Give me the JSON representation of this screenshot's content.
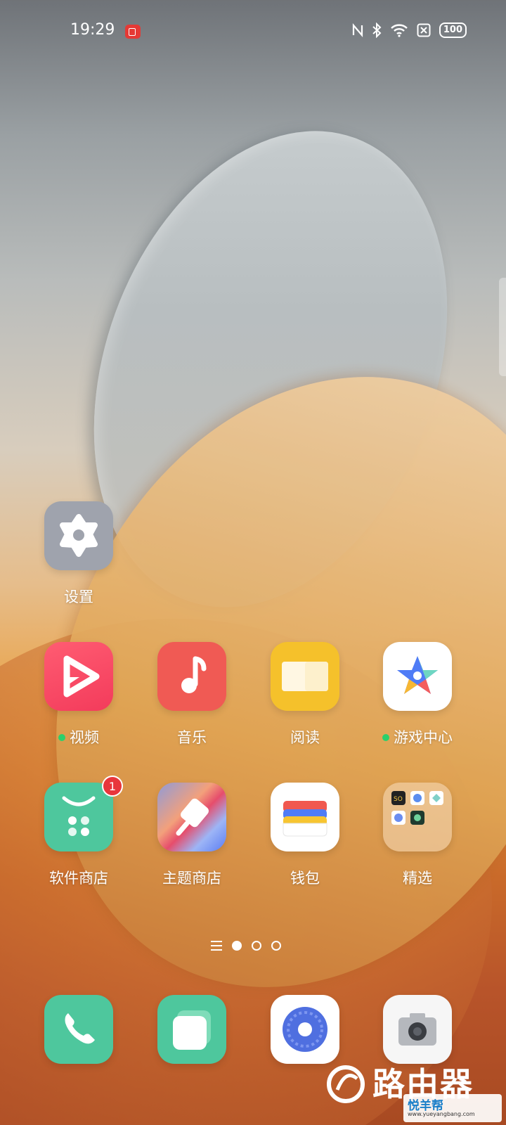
{
  "status_bar": {
    "time": "19:29",
    "icons": [
      "screen-record-icon",
      "nfc-icon",
      "bluetooth-icon",
      "wifi-icon",
      "sim-icon",
      "battery-icon"
    ],
    "battery": "100"
  },
  "apps": {
    "settings": "设置",
    "video": "视频",
    "music": "音乐",
    "reading": "阅读",
    "game_center": "游戏中心",
    "app_store": "软件商店",
    "theme_store": "主题商店",
    "wallet": "钱包",
    "featured_folder": "精选"
  },
  "badges": {
    "app_store": "1"
  },
  "indicators": {
    "video_new": "#2bd06b",
    "game_center_new": "#2bd06b"
  },
  "page_indicator": {
    "pages": 3,
    "current": 1
  },
  "dock": [
    "phone",
    "messages",
    "browser",
    "camera"
  ],
  "watermark": {
    "text": "路由器",
    "small_text": "悦羊帮",
    "url": "www.yueyangbang.com"
  }
}
